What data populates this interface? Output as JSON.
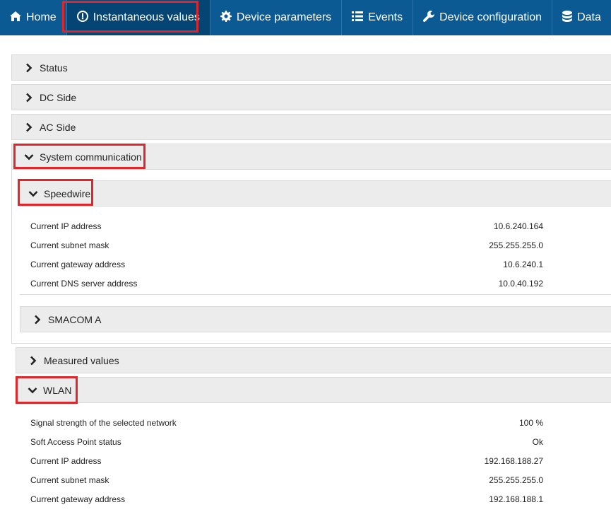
{
  "nav": {
    "items": [
      {
        "label": "Home",
        "icon": "home-icon"
      },
      {
        "label": "Instantaneous values",
        "icon": "gauge-icon",
        "active": true
      },
      {
        "label": "Device parameters",
        "icon": "gear-icon"
      },
      {
        "label": "Events",
        "icon": "list-icon"
      },
      {
        "label": "Device configuration",
        "icon": "wrench-icon"
      },
      {
        "label": "Data",
        "icon": "database-icon"
      }
    ]
  },
  "sections": {
    "status": "Status",
    "dc_side": "DC Side",
    "ac_side": "AC Side",
    "system_communication": "System communication",
    "speedwire": "Speedwire",
    "smacom_a": "SMACOM A",
    "measured_values": "Measured values",
    "wlan": "WLAN"
  },
  "speedwire_rows": [
    {
      "label": "Current IP address",
      "value": "10.6.240.164"
    },
    {
      "label": "Current subnet mask",
      "value": "255.255.255.0"
    },
    {
      "label": "Current gateway address",
      "value": "10.6.240.1"
    },
    {
      "label": "Current DNS server address",
      "value": "10.0.40.192"
    }
  ],
  "wlan_rows": [
    {
      "label": "Signal strength of the selected network",
      "value": "100 %"
    },
    {
      "label": "Soft Access Point status",
      "value": "Ok"
    },
    {
      "label": "Current IP address",
      "value": "192.168.188.27"
    },
    {
      "label": "Current subnet mask",
      "value": "255.255.255.0"
    },
    {
      "label": "Current gateway address",
      "value": "192.168.188.1"
    }
  ],
  "colors": {
    "navbar": "#0c5a94",
    "nav_active": "#054574",
    "highlight": "#e0262b",
    "panel_header": "#ececec"
  }
}
